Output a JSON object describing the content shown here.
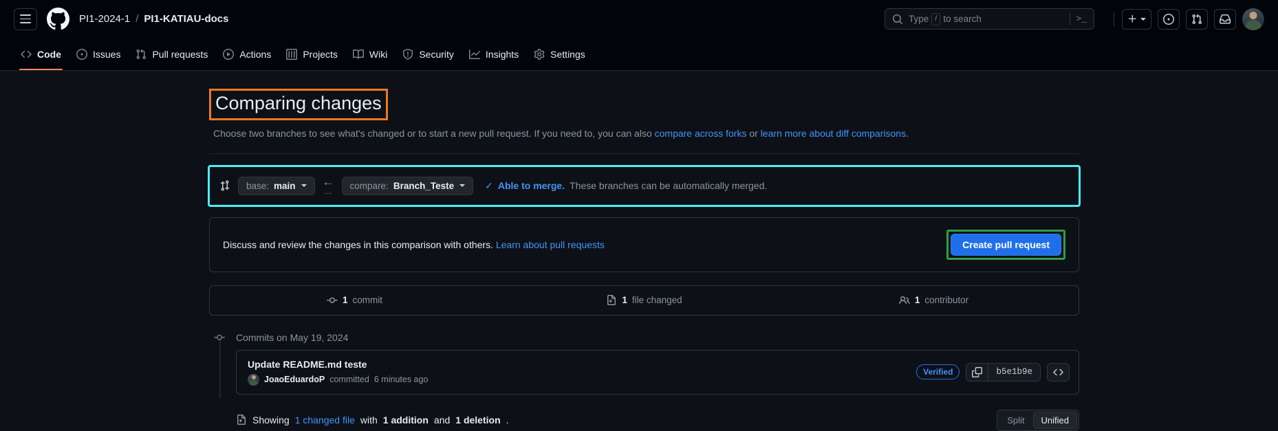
{
  "header": {
    "menu_icon": "hamburger-icon",
    "logo_icon": "github-logo-icon",
    "breadcrumb": {
      "owner": "PI1-2024-1",
      "separator": "/",
      "repo": "PI1-KATIAU-docs"
    },
    "search": {
      "icon": "search-icon",
      "placeholder_prefix": "Type",
      "key_hint": "/",
      "placeholder_suffix": "to search",
      "terminal_icon": ">_"
    },
    "actions": {
      "create_new": "plus-icon",
      "issues": "issue-opened-icon",
      "pull_requests": "git-pull-request-icon",
      "notifications": "inbox-icon",
      "avatar": "user-avatar"
    }
  },
  "nav": {
    "tabs": [
      {
        "label": "Code",
        "icon": "code-icon",
        "active": true
      },
      {
        "label": "Issues",
        "icon": "issue-opened-icon",
        "active": false
      },
      {
        "label": "Pull requests",
        "icon": "git-pull-request-icon",
        "active": false
      },
      {
        "label": "Actions",
        "icon": "play-icon",
        "active": false
      },
      {
        "label": "Projects",
        "icon": "table-icon",
        "active": false
      },
      {
        "label": "Wiki",
        "icon": "book-icon",
        "active": false
      },
      {
        "label": "Security",
        "icon": "shield-icon",
        "active": false
      },
      {
        "label": "Insights",
        "icon": "graph-icon",
        "active": false
      },
      {
        "label": "Settings",
        "icon": "gear-icon",
        "active": false
      }
    ]
  },
  "page": {
    "title": "Comparing changes",
    "subtitle_part1": "Choose two branches to see what's changed or to start a new pull request. If you need to, you can also ",
    "subtitle_link1": "compare across forks",
    "subtitle_mid": " or ",
    "subtitle_link2": "learn more about diff comparisons",
    "subtitle_end": "."
  },
  "branch_bar": {
    "compare_icon": "git-compare-icon",
    "base": {
      "label": "base:",
      "value": "main"
    },
    "arrow": "←",
    "dots": "…",
    "compare": {
      "label": "compare:",
      "value": "Branch_Teste"
    },
    "merge_check_icon": "✓",
    "merge_status_bold": "Able to merge.",
    "merge_status_rest": "These branches can be automatically merged."
  },
  "discuss": {
    "text": "Discuss and review the changes in this comparison with others.",
    "link": "Learn about pull requests",
    "button": "Create pull request"
  },
  "stats": [
    {
      "icon": "git-commit-icon",
      "count": "1",
      "label": "commit"
    },
    {
      "icon": "file-diff-icon",
      "count": "1",
      "label": "file changed"
    },
    {
      "icon": "people-icon",
      "count": "1",
      "label": "contributor"
    }
  ],
  "commits": {
    "date_header": "Commits on May 19, 2024",
    "items": [
      {
        "title": "Update README.md teste",
        "author": "JoaoEduardoP",
        "action": "committed",
        "time": "6 minutes ago",
        "verified_badge": "Verified",
        "sha": "b5e1b9e",
        "copy_icon": "copy-icon",
        "code_icon": "code-icon"
      }
    ]
  },
  "diff_summary": {
    "icon": "file-diff-icon",
    "prefix": "Showing",
    "changed_file_link": "1 changed file",
    "with": "with",
    "additions": "1 addition",
    "and": "and",
    "deletions": "1 deletion",
    "period": ".",
    "view_options": [
      {
        "label": "Split",
        "selected": false
      },
      {
        "label": "Unified",
        "selected": true
      }
    ]
  },
  "annotations": {
    "title_box_color": "#ef7622",
    "branch_box_color": "#49f0f7",
    "button_box_color": "#2ea043"
  }
}
